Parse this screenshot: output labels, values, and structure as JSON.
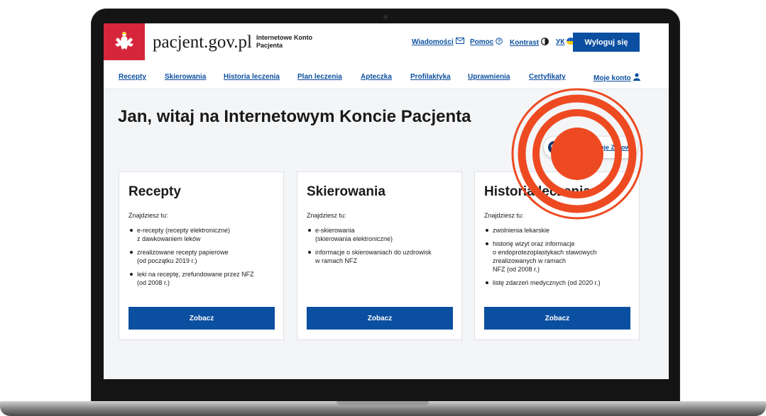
{
  "header": {
    "site_name": "pacjent.gov.pl",
    "site_sub": "Internetowe Konto Pacjenta",
    "links": {
      "messages": "Wiadomości",
      "help": "Pomoc",
      "contrast": "Kontrast",
      "language": "УК"
    },
    "logout": "Wyloguj się"
  },
  "nav": {
    "items": [
      "Recepty",
      "Skierowania",
      "Historia leczenia",
      "Plan leczenia",
      "Apteczka",
      "Profilaktyka",
      "Uprawnienia",
      "Certyfikaty"
    ],
    "account": "Moje konto"
  },
  "main": {
    "greeting": "Jan, witaj na Internetowym Koncie Pacjenta",
    "program_link": "Program Moje Zdrowie"
  },
  "cards": [
    {
      "title": "Recepty",
      "intro": "Znajdziesz tu:",
      "items": [
        "e-recepty (recepty elektroniczne)\nz dawkowaniem leków",
        "zrealizowane recepty papierowe\n(od początku 2019 r.)",
        "leki na receptę, zrefundowane przez NFZ\n(od 2008 r.)"
      ],
      "button": "Zobacz"
    },
    {
      "title": "Skierowania",
      "intro": "Znajdziesz tu:",
      "items": [
        "e-skierowania\n(skierowania elektroniczne)",
        "informacje o skierowaniach do uzdrowisk\nw ramach NFZ"
      ],
      "button": "Zobacz"
    },
    {
      "title": "Historia leczenia",
      "intro": "Znajdziesz tu:",
      "items": [
        "zwolnienia lekarskie",
        "historię wizyt oraz informacje\no endoprotezoplastykach stawowych\nzrealizowanych w ramach\nNFZ (od 2008 r.)",
        "listę zdarzeń medycznych (od 2020 r.)"
      ],
      "button": "Zobacz"
    }
  ],
  "colors": {
    "accent_blue": "#0b4fa0",
    "emblem_red": "#d6263b",
    "highlight_orange": "#ee4a22",
    "program_dot": "#14366e"
  },
  "icons": {
    "emblem": "white-eagle-emblem",
    "messages": "envelope-icon",
    "help": "question-circle-icon",
    "contrast": "contrast-circle-icon",
    "language": "ukraine-flag-icon",
    "account": "user-icon",
    "program": "heart-icon"
  }
}
